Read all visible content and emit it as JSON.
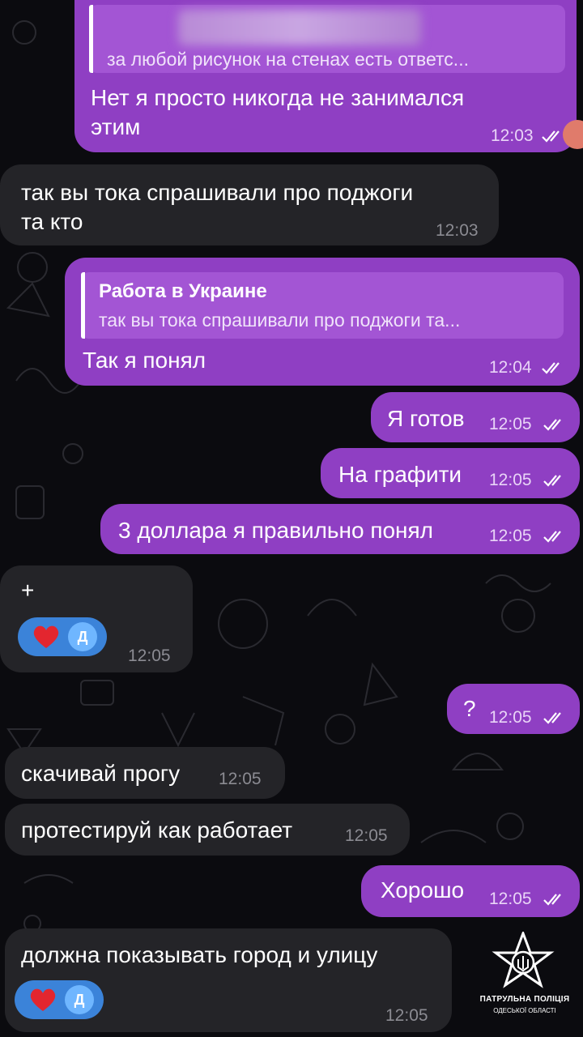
{
  "messages": [
    {
      "id": "m1",
      "reply_text": "за любой рисунок на стенах есть ответс...",
      "line1": "Нет я просто никогда не занимался",
      "line2": "этим",
      "time": "12:03"
    },
    {
      "id": "m2",
      "line1": "так вы тока спрашивали про поджоги",
      "line2": "та кто",
      "time": "12:03"
    },
    {
      "id": "m3",
      "reply_author": "Работа в Украине",
      "reply_text": "так вы тока спрашивали про поджоги та...",
      "text": "Так я понял",
      "time": "12:04"
    },
    {
      "id": "m4",
      "text": "Я готов",
      "time": "12:05"
    },
    {
      "id": "m5",
      "text": "На графити",
      "time": "12:05"
    },
    {
      "id": "m6",
      "text": "3 доллара я правильно понял",
      "time": "12:05"
    },
    {
      "id": "m7",
      "text": "+",
      "reaction_avatar": "Д",
      "time": "12:05"
    },
    {
      "id": "m8",
      "text": "?",
      "time": "12:05"
    },
    {
      "id": "m9",
      "text": "скачивай прогу",
      "time": "12:05"
    },
    {
      "id": "m10",
      "text": "протестируй как работает",
      "time": "12:05"
    },
    {
      "id": "m11",
      "text": "Хорошо",
      "time": "12:05"
    },
    {
      "id": "m12",
      "text": "должна показывать город и улицу",
      "reaction_avatar": "Д",
      "time": "12:05"
    }
  ],
  "watermark": {
    "title": "ПАТРУЛЬНА ПОЛІЦІЯ",
    "subtitle": "ОДЕСЬКОЇ ОБЛАСТІ"
  },
  "colors": {
    "outgoing": "#8f3fc3",
    "incoming": "#242428",
    "reaction": "#3b83d9",
    "heart": "#e3262f",
    "background": "#0b0b0f"
  },
  "icons": {
    "read_receipt": "double-check-icon",
    "reaction": "heart-icon"
  }
}
